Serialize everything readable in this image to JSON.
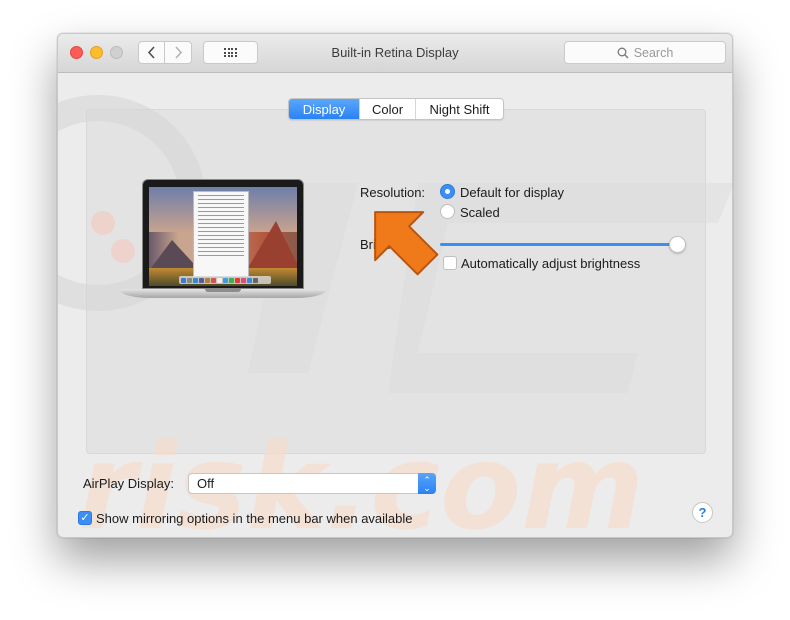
{
  "window": {
    "title": "Built-in Retina Display",
    "search_placeholder": "Search"
  },
  "toolbar": {
    "back_icon": "chevron-left-icon",
    "forward_icon": "chevron-right-icon",
    "show_all_icon": "grid-icon"
  },
  "tabs": [
    {
      "label": "Display",
      "active": true
    },
    {
      "label": "Color",
      "active": false
    },
    {
      "label": "Night Shift",
      "active": false
    }
  ],
  "display": {
    "resolution_label": "Resolution:",
    "resolution_options": [
      {
        "label": "Default for display",
        "selected": true
      },
      {
        "label": "Scaled",
        "selected": false
      }
    ],
    "brightness_label": "Brightness:",
    "brightness_value": 1.0,
    "auto_brightness_label": "Automatically adjust brightness",
    "auto_brightness_checked": false
  },
  "airplay": {
    "label": "AirPlay Display:",
    "value": "Off"
  },
  "mirroring": {
    "label": "Show mirroring options in the menu bar when available",
    "checked": true
  },
  "help": {
    "label": "?"
  },
  "colors": {
    "accent": "#3b8ef5",
    "annotation_arrow": "#f07a1a",
    "close": "#fc5b57",
    "minimize": "#fdbc2e",
    "zoom_disabled": "#d0d0d0"
  },
  "watermark": {
    "text_top": "PC",
    "text_bottom": "risk.com"
  }
}
